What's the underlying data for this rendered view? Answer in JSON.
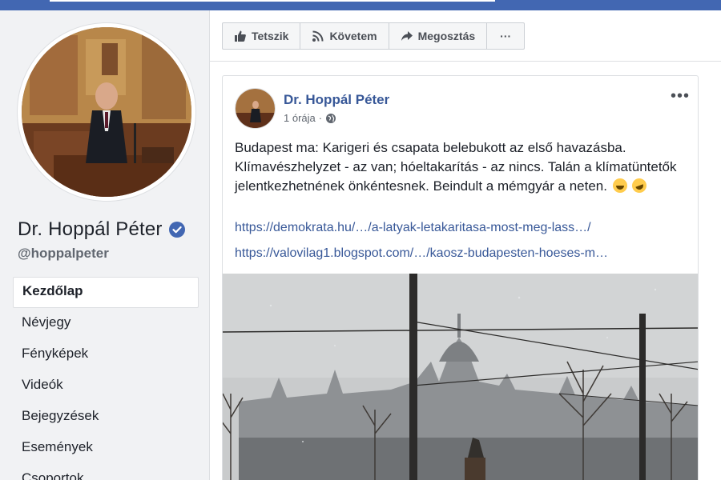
{
  "page": {
    "name": "Dr. Hoppál Péter",
    "handle": "@hoppalpeter"
  },
  "nav": {
    "items": [
      {
        "label": "Kezdőlap",
        "active": true
      },
      {
        "label": "Névjegy"
      },
      {
        "label": "Fényképek"
      },
      {
        "label": "Videók"
      },
      {
        "label": "Bejegyzések"
      },
      {
        "label": "Események"
      },
      {
        "label": "Csoportok"
      }
    ]
  },
  "actions": {
    "like": "Tetszik",
    "follow": "Követem",
    "share": "Megosztás",
    "more": "···"
  },
  "post": {
    "author": "Dr. Hoppál Péter",
    "time": "1 órája",
    "dot": "·",
    "more": "•••",
    "text": "Budapest ma: Karigeri és csapata belebukott az első havazásba. Klímavészhelyzet - az van; hóeltakarítás - az nincs. Talán a klímatüntetők jelentkezhetnének önkéntesnek. Beindult a mémgyár a neten.",
    "link1": "https://demokrata.hu/…/a-latyak-letakaritasa-most-meg-lass…/",
    "link2": "https://valovilag1.blogspot.com/…/kaosz-budapesten-hoeses-m…",
    "emojis": [
      "laughing-emoji",
      "rofl-emoji"
    ]
  },
  "colors": {
    "brand": "#4267b2",
    "link": "#385898",
    "verified": "#4267b2"
  }
}
